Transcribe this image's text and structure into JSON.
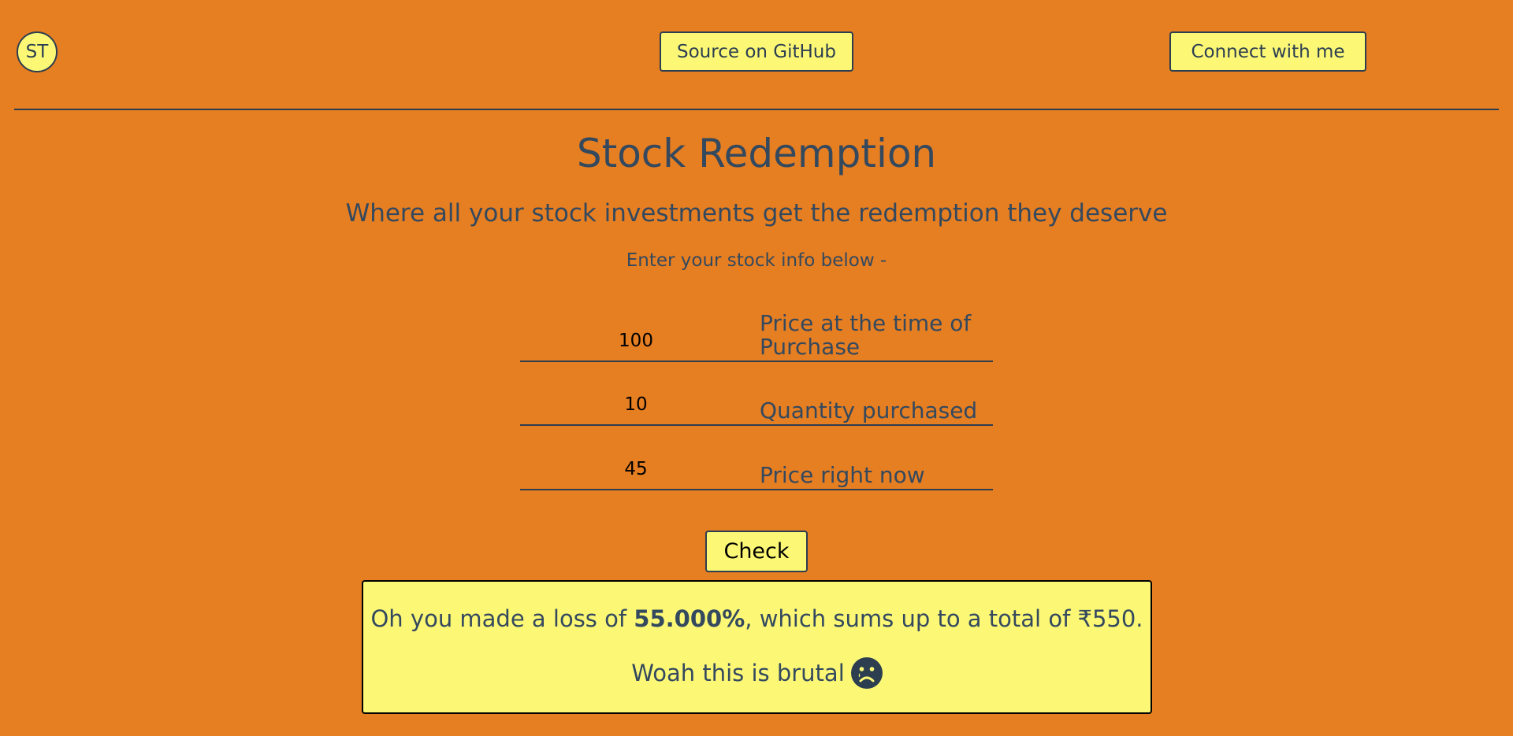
{
  "nav": {
    "logo": "ST",
    "github_label": "Source on GitHub",
    "connect_label": "Connect with me"
  },
  "header": {
    "title": "Stock Redemption",
    "subtitle": "Where all your stock investments get the redemption they deserve",
    "hint": "Enter your stock info below -"
  },
  "form": {
    "purchase_price": {
      "value": "100",
      "label": "Price at the time of Purchase"
    },
    "quantity": {
      "value": "10",
      "label": "Quantity purchased"
    },
    "current_price": {
      "value": "45",
      "label": "Price right now"
    },
    "check_label": "Check"
  },
  "result": {
    "line1_prefix": "Oh you made a loss of ",
    "percent": "55.000%",
    "line1_suffix": ", which sums up to a total of ₹550.",
    "line2": "Woah this is brutal",
    "icon": "sad-face-icon"
  },
  "colors": {
    "background": "#e67e22",
    "accent": "#fcf876",
    "text": "#2c3e50"
  }
}
